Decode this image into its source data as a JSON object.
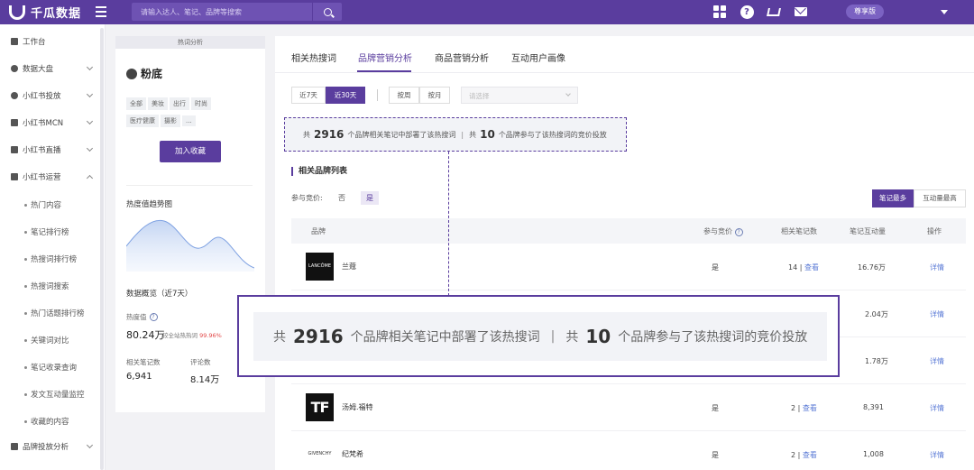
{
  "topbar": {
    "app_name": "千瓜数据",
    "search_placeholder": "请输入达人、笔记、品牌等搜索",
    "version": "尊享版"
  },
  "sidebar": {
    "items": [
      {
        "label": "工作台",
        "icon": "dashboard-icon",
        "arrow": false
      },
      {
        "label": "数据大盘",
        "icon": "chart-icon",
        "arrow": true
      },
      {
        "label": "小红书投放",
        "icon": "shield-icon",
        "arrow": true
      },
      {
        "label": "小红书MCN",
        "icon": "building-icon",
        "arrow": true
      },
      {
        "label": "小红书直播",
        "icon": "video-icon",
        "arrow": true
      },
      {
        "label": "小红书运营",
        "icon": "briefcase-icon",
        "arrow": true
      }
    ],
    "subitems": [
      "热门内容",
      "笔记排行榜",
      "热搜词排行榜",
      "热搜词搜索",
      "热门话题排行榜",
      "关键词对比",
      "笔记收录查询",
      "发文互动量监控",
      "收藏的内容"
    ],
    "last_item": {
      "label": "品牌投放分析",
      "icon": "bar-chart-icon"
    }
  },
  "panel": {
    "header": "热词分析",
    "keyword": "粉底",
    "tags": [
      "全部",
      "美妆",
      "出行",
      "时尚",
      "医疗健康",
      "摄影",
      "..."
    ],
    "fav_button": "加入收藏",
    "trend_title": "热度值趋势图",
    "overview_title": "数据概览（近7天）",
    "heat_label": "热度值",
    "heat_value": "80.24万",
    "heat_compare_prefix": "较全站热热词",
    "heat_compare_value": "99.96%",
    "notes_label": "相关笔记数",
    "notes_value": "6,941",
    "comments_label": "评论数",
    "comments_value": "8.14万"
  },
  "main": {
    "tabs": [
      "相关热搜词",
      "品牌营销分析",
      "商品营销分析",
      "互动用户画像"
    ],
    "active_tab": 1,
    "filters": {
      "days7": "近7天",
      "days30": "近30天",
      "week": "按周",
      "month": "按月",
      "select_placeholder": "请选择"
    },
    "summary": {
      "prefix": "共",
      "brand_count": "2916",
      "mid": "个品牌相关笔记中部署了该热搜词",
      "sep": "|",
      "prefix2": "共",
      "bid_count": "10",
      "suffix": "个品牌参与了该热搜词的竞价投放"
    },
    "list_title": "相关品牌列表",
    "bid_label": "参与竞价:",
    "bid_no": "否",
    "bid_yes": "是",
    "sort_notes": "笔记最多",
    "sort_interact": "互动量最高",
    "columns": [
      "品牌",
      "参与竞价",
      "相关笔记数",
      "笔记互动量",
      "操作"
    ],
    "view_label": "查看",
    "detail_label": "详情",
    "rows": [
      {
        "logo": "LANCÔME",
        "name": "兰蔻",
        "bid": "是",
        "notes": "14",
        "interact": "16.76万"
      },
      {
        "logo": "",
        "name": "",
        "bid": "",
        "notes": "",
        "interact": "2.04万"
      },
      {
        "logo": "",
        "name": "",
        "bid": "",
        "notes": "",
        "interact": "1.78万"
      },
      {
        "logo": "TF",
        "name": "汤姆.福特",
        "bid": "是",
        "notes": "2",
        "interact": "8,391"
      },
      {
        "logo": "GIVENCHY",
        "name": "纪梵希",
        "bid": "是",
        "notes": "2",
        "interact": "1,008"
      }
    ]
  }
}
